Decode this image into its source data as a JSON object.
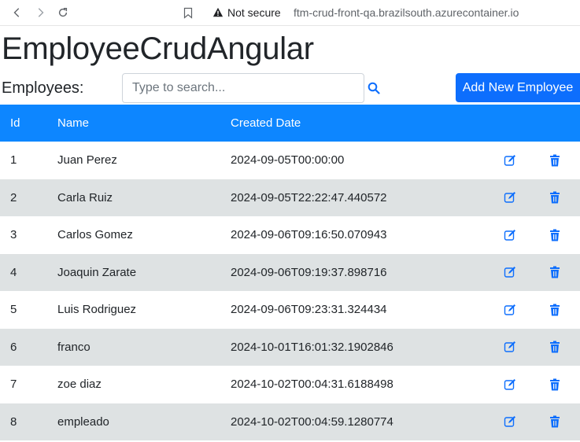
{
  "browser": {
    "back_icon": "arrow-left-icon",
    "forward_icon": "arrow-right-icon",
    "reload_icon": "reload-icon",
    "bookmark_icon": "bookmark-icon",
    "security_label": "Not secure",
    "url": "ftm-crud-front-qa.brazilsouth.azurecontainer.io"
  },
  "page": {
    "title": "EmployeeCrudAngular"
  },
  "toolbar": {
    "employees_label": "Employees:",
    "search_placeholder": "Type to search...",
    "search_value": "",
    "search_icon": "search-icon",
    "add_label": "Add New Employee"
  },
  "colors": {
    "primary": "#0d6efd",
    "header_bg": "#0d86ff",
    "stripe_bg": "#dee2e3"
  },
  "table": {
    "headers": [
      "Id",
      "Name",
      "Created Date"
    ],
    "edit_icon": "edit-icon",
    "delete_icon": "trash-icon",
    "rows": [
      {
        "id": "1",
        "name": "Juan Perez",
        "created": "2024-09-05T00:00:00"
      },
      {
        "id": "2",
        "name": "Carla Ruiz",
        "created": "2024-09-05T22:22:47.440572"
      },
      {
        "id": "3",
        "name": "Carlos Gomez",
        "created": "2024-09-06T09:16:50.070943"
      },
      {
        "id": "4",
        "name": "Joaquin Zarate",
        "created": "2024-09-06T09:19:37.898716"
      },
      {
        "id": "5",
        "name": "Luis Rodriguez",
        "created": "2024-09-06T09:23:31.324434"
      },
      {
        "id": "6",
        "name": "franco",
        "created": "2024-10-01T16:01:32.1902846"
      },
      {
        "id": "7",
        "name": "zoe diaz",
        "created": "2024-10-02T00:04:31.6188498"
      },
      {
        "id": "8",
        "name": "empleado",
        "created": "2024-10-02T00:04:59.1280774"
      }
    ]
  }
}
